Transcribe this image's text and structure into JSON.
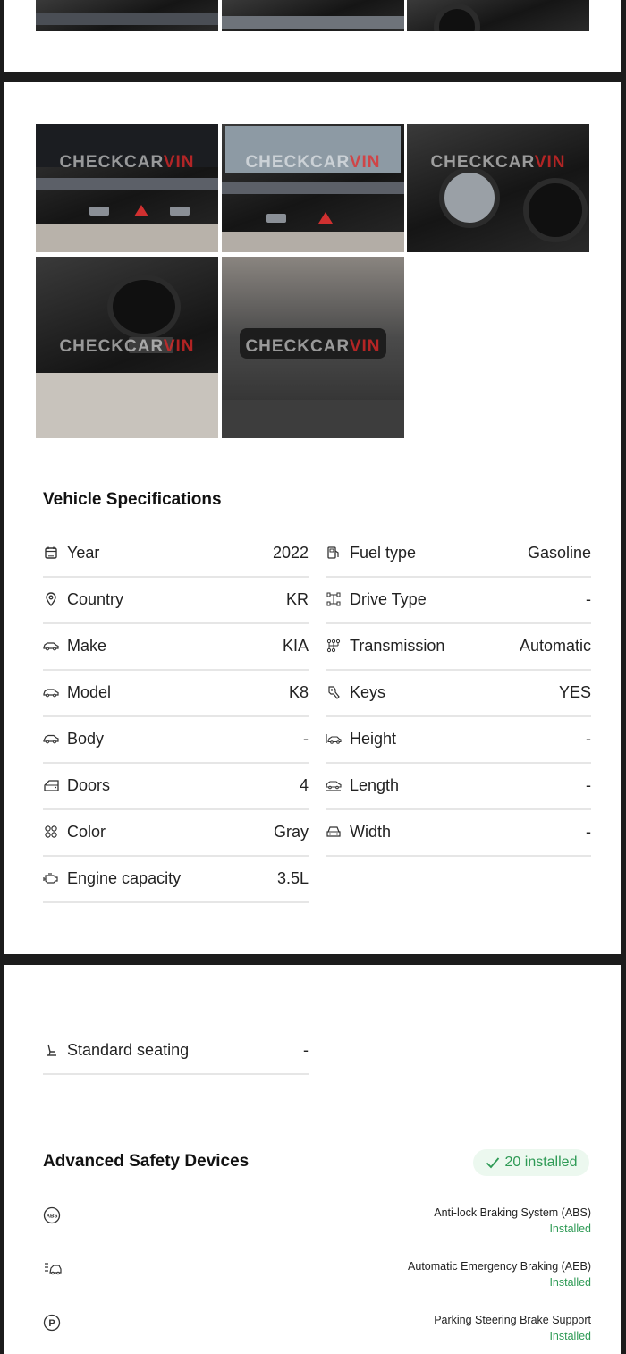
{
  "photos": {
    "watermark_brand": "CHECKCAR",
    "watermark_suffix": "VIN"
  },
  "specs": {
    "title": "Vehicle Specifications",
    "left": [
      {
        "label": "Year",
        "value": "2022",
        "icon": "calendar-icon"
      },
      {
        "label": "Country",
        "value": "KR",
        "icon": "location-pin-icon"
      },
      {
        "label": "Make",
        "value": "KIA",
        "icon": "car-icon"
      },
      {
        "label": "Model",
        "value": "K8",
        "icon": "car-icon"
      },
      {
        "label": "Body",
        "value": "-",
        "icon": "car-body-icon"
      },
      {
        "label": "Doors",
        "value": "4",
        "icon": "door-icon"
      },
      {
        "label": "Color",
        "value": "Gray",
        "icon": "color-grid-icon"
      },
      {
        "label": "Engine capacity",
        "value": "3.5L",
        "icon": "engine-icon"
      }
    ],
    "right": [
      {
        "label": "Fuel type",
        "value": "Gasoline",
        "icon": "fuel-pump-icon"
      },
      {
        "label": "Drive Type",
        "value": "-",
        "icon": "drivetrain-icon"
      },
      {
        "label": "Transmission",
        "value": "Automatic",
        "icon": "gearbox-icon"
      },
      {
        "label": "Keys",
        "value": "YES",
        "icon": "key-icon"
      },
      {
        "label": "Height",
        "value": "-",
        "icon": "car-height-icon"
      },
      {
        "label": "Length",
        "value": "-",
        "icon": "car-length-icon"
      },
      {
        "label": "Width",
        "value": "-",
        "icon": "car-width-icon"
      }
    ],
    "seating": {
      "label": "Standard seating",
      "value": "-",
      "icon": "seat-icon"
    }
  },
  "safety": {
    "title": "Advanced Safety Devices",
    "badge": "20 installed",
    "badge_color": "#2e9a55",
    "items": [
      {
        "name": "Anti-lock Braking System (ABS)",
        "status": "Installed",
        "icon": "abs-icon"
      },
      {
        "name": "Automatic Emergency Braking (AEB)",
        "status": "Installed",
        "icon": "aeb-icon"
      },
      {
        "name": "Parking Steering Brake Support",
        "status": "Installed",
        "icon": "parking-icon"
      }
    ]
  }
}
